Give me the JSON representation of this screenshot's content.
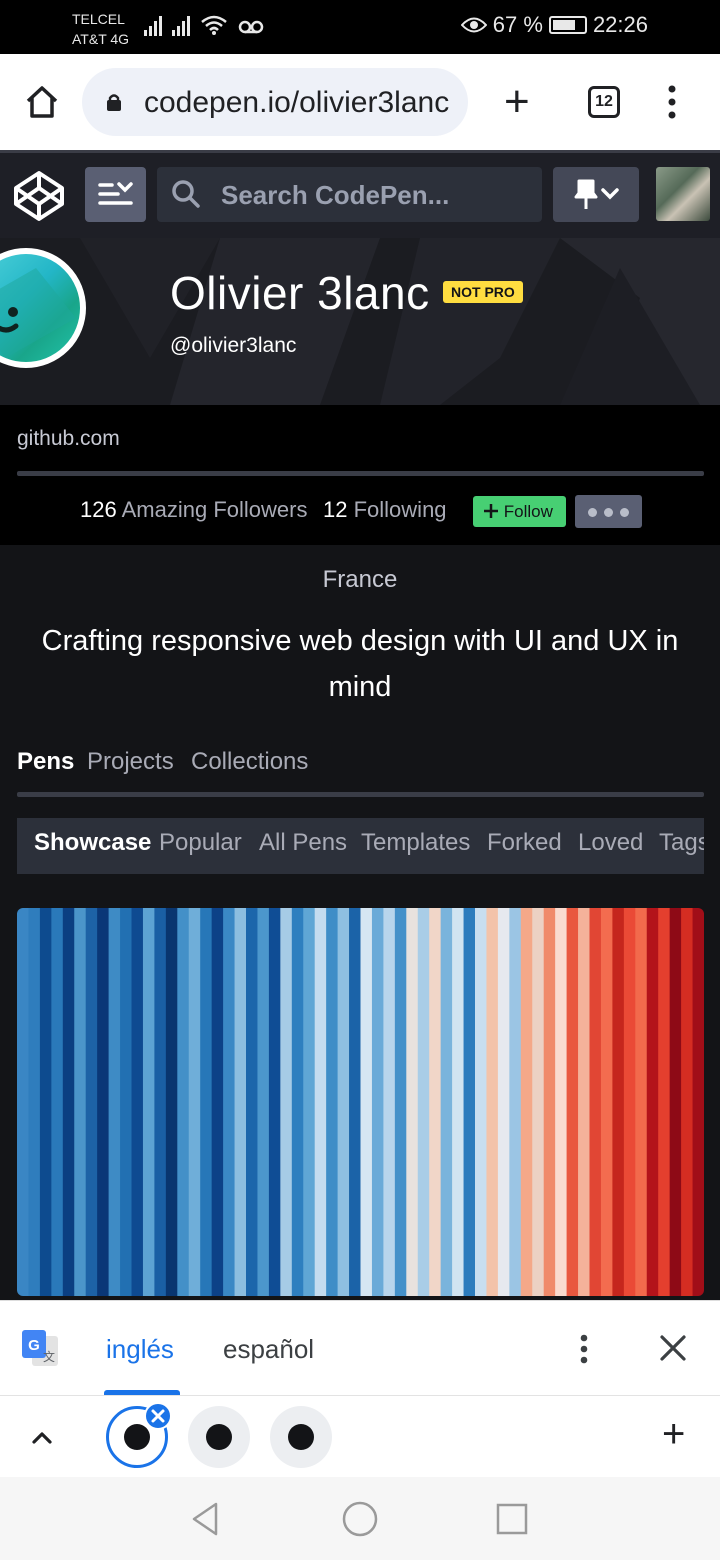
{
  "status_bar": {
    "carrier_1": "TELCEL",
    "carrier_2": "AT&T 4G",
    "battery": "67 %",
    "time": "22:26"
  },
  "browser": {
    "url": "codepen.io/olivier3lanc",
    "tab_count": "12"
  },
  "codepen_header": {
    "search_placeholder": "Search CodePen..."
  },
  "profile": {
    "name": "Olivier 3lanc",
    "badge": "NOT PRO",
    "handle": "@olivier3lanc",
    "link": "github.com",
    "followers_count": "126",
    "followers_label": "Amazing Followers",
    "following_count": "12",
    "following_label": "Following",
    "follow_button": "Follow",
    "location": "France",
    "bio": "Crafting responsive web design with UI and UX in mind"
  },
  "tabs": [
    {
      "label": "Pens",
      "active": true
    },
    {
      "label": "Projects",
      "active": false
    },
    {
      "label": "Collections",
      "active": false
    }
  ],
  "sub_tabs": [
    {
      "label": "Showcase",
      "active": true
    },
    {
      "label": "Popular",
      "active": false
    },
    {
      "label": "All Pens",
      "active": false
    },
    {
      "label": "Templates",
      "active": false
    },
    {
      "label": "Forked",
      "active": false
    },
    {
      "label": "Loved",
      "active": false
    },
    {
      "label": "Tags",
      "active": false
    }
  ],
  "translate_bar": {
    "source_language": "inglés",
    "target_language": "español"
  },
  "colors": {
    "codepen_bg": "#131417",
    "follow_green": "#47cf73",
    "not_pro_yellow": "#ffdd40",
    "google_blue": "#1a73e8"
  },
  "stripes": [
    "#3a86c4",
    "#2f7dbd",
    "#0d4b8f",
    "#2a79ba",
    "#0b3f82",
    "#4b95ca",
    "#1d62a6",
    "#0a3777",
    "#3e8bc5",
    "#2270b2",
    "#0e4a91",
    "#5da3d3",
    "#1a5fa4",
    "#09356f",
    "#4390c8",
    "#6faed9",
    "#2777b8",
    "#0c4187",
    "#3a88c5",
    "#8cbee0",
    "#1c66ab",
    "#4c97cc",
    "#0f4d95",
    "#a6cbe6",
    "#2e7fbf",
    "#5fa6d5",
    "#c4dcef",
    "#3f8dc7",
    "#8ebfe1",
    "#1b63a8",
    "#d6e6f2",
    "#6aaad8",
    "#b8d5ec",
    "#4591c9",
    "#e8e2de",
    "#a9cde7",
    "#f1d6c8",
    "#7ab4dc",
    "#d1e4f1",
    "#2c7cbd",
    "#c8def0",
    "#f3c3aa",
    "#e6e9ef",
    "#9bc5e4",
    "#f4a889",
    "#ecd1c4",
    "#f08a6a",
    "#fadbcf",
    "#e9583f",
    "#f4b29a",
    "#e14634",
    "#f36c4f",
    "#c5261d",
    "#ea4a36",
    "#f26a4c",
    "#b3131a",
    "#e43f2e",
    "#8e0a16",
    "#d52d22",
    "#a10e18"
  ]
}
